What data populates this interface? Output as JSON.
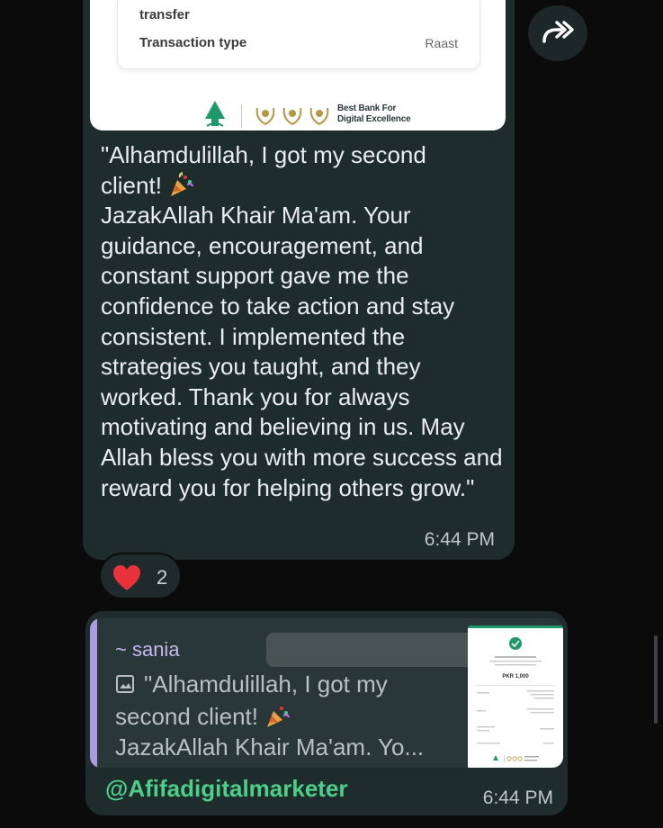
{
  "receipt": {
    "transfer_text": "transfer",
    "transaction_type_label": "Transaction type",
    "transaction_type_value": "Raast",
    "award_line1": "Best Bank For",
    "award_line2": "Digital Excellence"
  },
  "message": {
    "line1": "\"Alhamdulillah, I got my second",
    "line2": "client!",
    "body": "JazakAllah Khair Ma'am. Your guidance, encouragement, and constant support gave me the confidence to take action and stay consistent. I implemented the strategies you taught, and they worked. Thank you for always motivating and believing in us. May Allah bless you with more success and reward you for helping others grow.\"",
    "time": "6:44 PM",
    "reaction_count": "2"
  },
  "reply": {
    "quoted_name": "~ sania",
    "quoted_line1": "\"Alhamdulillah, I got my",
    "quoted_line2": "second client!",
    "quoted_line3": "JazakAllah Khair Ma'am. Yo...",
    "thumb_amount": "PKR 1,000",
    "mention": "@Afifadigitalmarketer",
    "time": "6:44 PM"
  },
  "colors": {
    "bubble": "#1f2c2c",
    "quote_bar": "#a89be0",
    "mention": "#4ccf88",
    "heart": "#e8323c"
  },
  "icons": {
    "forward": "forward-icon",
    "heart": "heart-icon",
    "party_popper": "party-popper-icon",
    "image": "image-icon",
    "bank_logo": "bank-logo-icon",
    "award": "award-laurel-icon",
    "check": "check-icon"
  }
}
